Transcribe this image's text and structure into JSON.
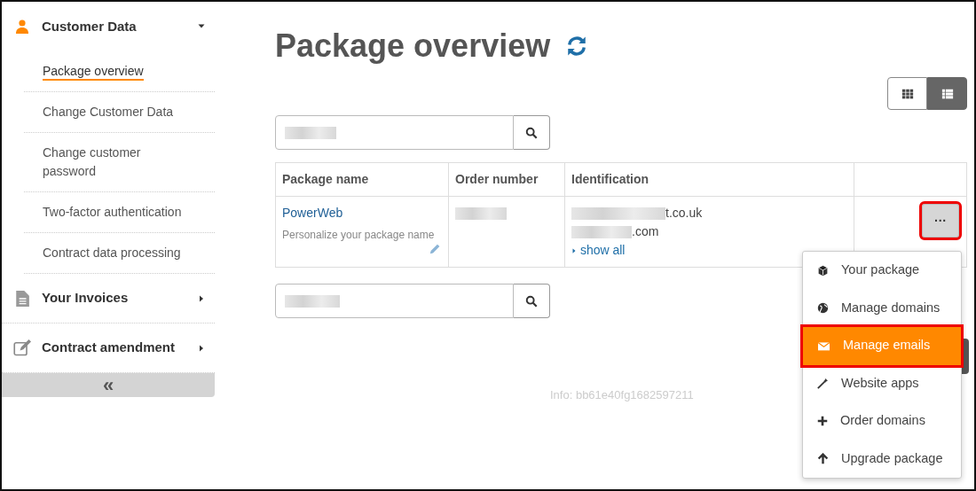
{
  "sidebar": {
    "sections": [
      {
        "kind": "person",
        "label": "Customer Data",
        "expanded": true,
        "children": [
          {
            "label": "Package overview",
            "selected": true
          },
          {
            "label": "Change Customer Data",
            "selected": false
          },
          {
            "label": "Change customer password",
            "selected": false
          },
          {
            "label": "Two-factor authentication",
            "selected": false
          },
          {
            "label": "Contract data processing",
            "selected": false
          }
        ]
      },
      {
        "kind": "document",
        "label": "Your Invoices",
        "expanded": false
      },
      {
        "kind": "edit",
        "label": "Contract amendment",
        "expanded": false
      }
    ],
    "collapse_button": "«"
  },
  "page_title": "Package overview",
  "view_toggle": [
    {
      "kind": "grid",
      "selected": false
    },
    {
      "kind": "list",
      "selected": true
    }
  ],
  "table": {
    "columns": [
      "Package name",
      "Order number",
      "Identification"
    ],
    "rows": [
      {
        "package_name": "PowerWeb",
        "hint": "Personalize your package name",
        "identification": [
          "t.co.uk",
          ".com"
        ],
        "show_all": "show all"
      }
    ]
  },
  "actions_button": {
    "label": "···",
    "highlighted": true
  },
  "actions_menu": {
    "items": [
      {
        "kind": "package",
        "label": "Your package",
        "selected": false,
        "highlighted": false
      },
      {
        "kind": "globe",
        "label": "Manage domains",
        "selected": false,
        "highlighted": false
      },
      {
        "kind": "mail",
        "label": "Manage emails",
        "selected": true,
        "highlighted": true
      },
      {
        "kind": "wand",
        "label": "Website apps",
        "selected": false,
        "highlighted": false
      },
      {
        "kind": "plus",
        "label": "Order domains",
        "selected": false,
        "highlighted": false
      },
      {
        "kind": "up",
        "label": "Upgrade package",
        "selected": false,
        "highlighted": false
      }
    ]
  },
  "info": "Info: bb61e40fg1682597211"
}
